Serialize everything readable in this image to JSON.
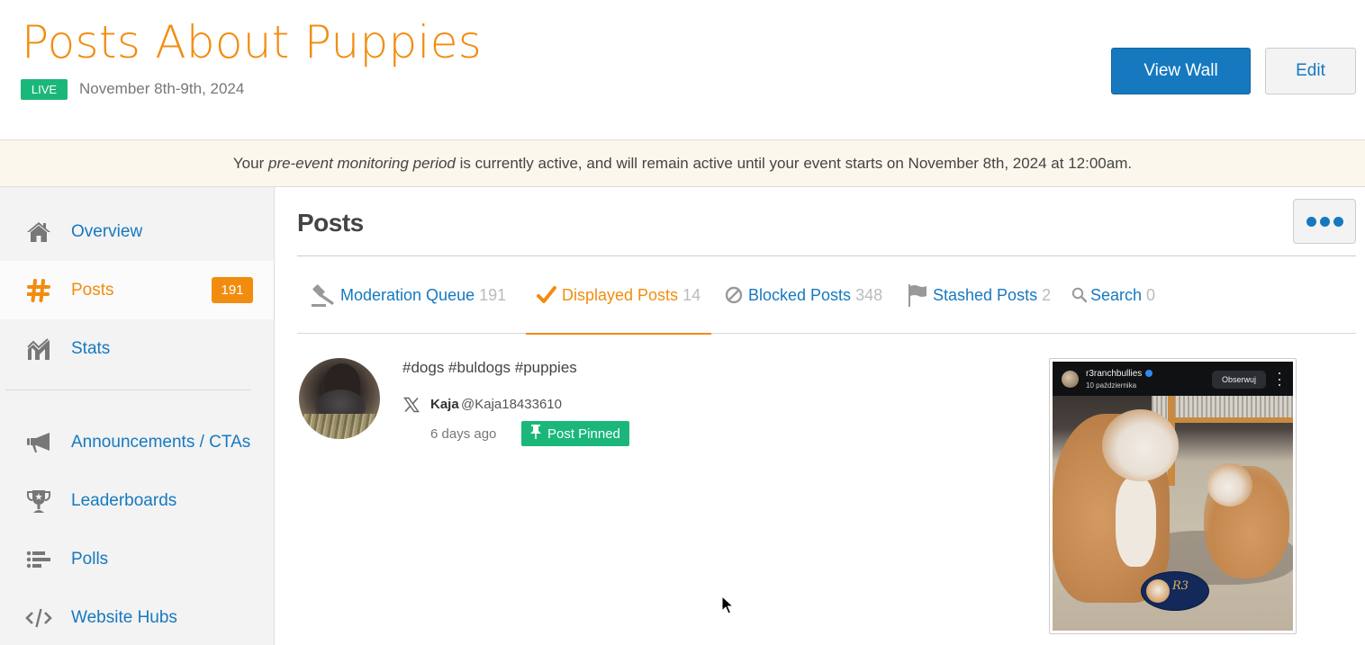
{
  "header": {
    "title": "Posts About Puppies",
    "status_badge": "LIVE",
    "dates": "November 8th-9th, 2024",
    "view_wall_label": "View Wall",
    "edit_label": "Edit"
  },
  "banner": {
    "prefix": "Your ",
    "emphasis": "pre-event monitoring period",
    "suffix": " is currently active, and will remain active until your event starts on November 8th, 2024 at 12:00am."
  },
  "sidebar": {
    "items": [
      {
        "label": "Overview",
        "icon": "home-icon"
      },
      {
        "label": "Posts",
        "icon": "hashtag-icon",
        "count": "191",
        "active": true
      },
      {
        "label": "Stats",
        "icon": "chart-icon"
      },
      {
        "label": "Announcements / CTAs",
        "icon": "megaphone-icon"
      },
      {
        "label": "Leaderboards",
        "icon": "trophy-icon"
      },
      {
        "label": "Polls",
        "icon": "list-icon"
      },
      {
        "label": "Website Hubs",
        "icon": "code-icon"
      }
    ]
  },
  "main": {
    "heading": "Posts",
    "more_label": "More options",
    "tabs": [
      {
        "label": "Moderation Queue",
        "count": "191",
        "icon": "gavel-icon"
      },
      {
        "label": "Displayed Posts",
        "count": "14",
        "icon": "checkmark-icon",
        "active": true
      },
      {
        "label": "Blocked Posts",
        "count": "348",
        "icon": "blocked-icon"
      },
      {
        "label": "Stashed Posts",
        "count": "2",
        "icon": "flag-icon"
      },
      {
        "label": "Search",
        "count": "0",
        "icon": "search-icon"
      }
    ],
    "post": {
      "text": "#dogs #buldogs #puppies",
      "network": "x-icon",
      "author_name": "Kaja",
      "author_handle": "@Kaja18433610",
      "age": "6 days ago",
      "pinned_label": "Post Pinned",
      "media": {
        "ig_username": "r3ranchbullies",
        "ig_date": "10 października",
        "ig_follow_label": "Obserwuj",
        "logo_text": "R3"
      }
    }
  },
  "colors": {
    "accent_orange": "#f28c0f",
    "link_blue": "#1679bf",
    "live_green": "#1bb77a",
    "banner_bg": "#fcf7ed"
  }
}
